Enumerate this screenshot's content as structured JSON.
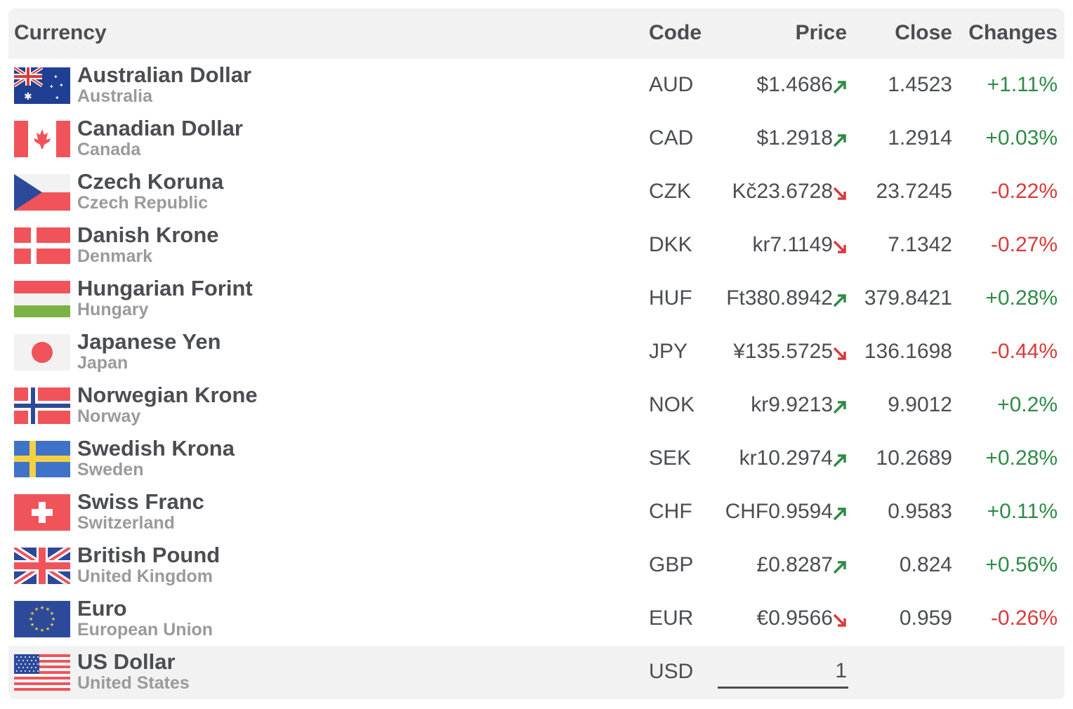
{
  "header": {
    "currency": "Currency",
    "code": "Code",
    "price": "Price",
    "close": "Close",
    "changes": "Changes"
  },
  "colors": {
    "up": "#2e8b46",
    "down": "#d93a3a",
    "text": "#4a4d52",
    "muted": "#9a9a9a"
  },
  "rows": [
    {
      "name": "Australian Dollar",
      "country": "Australia",
      "code": "AUD",
      "price": "$1.4686",
      "trend": "up",
      "close": "1.4523",
      "change": "+1.11%",
      "flag": "australia-flag-icon"
    },
    {
      "name": "Canadian Dollar",
      "country": "Canada",
      "code": "CAD",
      "price": "$1.2918",
      "trend": "up",
      "close": "1.2914",
      "change": "+0.03%",
      "flag": "canada-flag-icon"
    },
    {
      "name": "Czech Koruna",
      "country": "Czech Republic",
      "code": "CZK",
      "price": "Kč23.6728",
      "trend": "down",
      "close": "23.7245",
      "change": "-0.22%",
      "flag": "czech-flag-icon"
    },
    {
      "name": "Danish Krone",
      "country": "Denmark",
      "code": "DKK",
      "price": "kr7.1149",
      "trend": "down",
      "close": "7.1342",
      "change": "-0.27%",
      "flag": "denmark-flag-icon"
    },
    {
      "name": "Hungarian Forint",
      "country": "Hungary",
      "code": "HUF",
      "price": "Ft380.8942",
      "trend": "up",
      "close": "379.8421",
      "change": "+0.28%",
      "flag": "hungary-flag-icon"
    },
    {
      "name": "Japanese Yen",
      "country": "Japan",
      "code": "JPY",
      "price": "¥135.5725",
      "trend": "down",
      "close": "136.1698",
      "change": "-0.44%",
      "flag": "japan-flag-icon"
    },
    {
      "name": "Norwegian Krone",
      "country": "Norway",
      "code": "NOK",
      "price": "kr9.9213",
      "trend": "up",
      "close": "9.9012",
      "change": "+0.2%",
      "flag": "norway-flag-icon"
    },
    {
      "name": "Swedish Krona",
      "country": "Sweden",
      "code": "SEK",
      "price": "kr10.2974",
      "trend": "up",
      "close": "10.2689",
      "change": "+0.28%",
      "flag": "sweden-flag-icon"
    },
    {
      "name": "Swiss Franc",
      "country": "Switzerland",
      "code": "CHF",
      "price": "CHF0.9594",
      "trend": "up",
      "close": "0.9583",
      "change": "+0.11%",
      "flag": "switzerland-flag-icon"
    },
    {
      "name": "British Pound",
      "country": "United Kingdom",
      "code": "GBP",
      "price": "£0.8287",
      "trend": "up",
      "close": "0.824",
      "change": "+0.56%",
      "flag": "uk-flag-icon"
    },
    {
      "name": "Euro",
      "country": "European Union",
      "code": "EUR",
      "price": "€0.9566",
      "trend": "down",
      "close": "0.959",
      "change": "-0.26%",
      "flag": "eu-flag-icon"
    }
  ],
  "base": {
    "name": "US Dollar",
    "country": "United States",
    "code": "USD",
    "amount": "1",
    "flag": "usa-flag-icon"
  }
}
